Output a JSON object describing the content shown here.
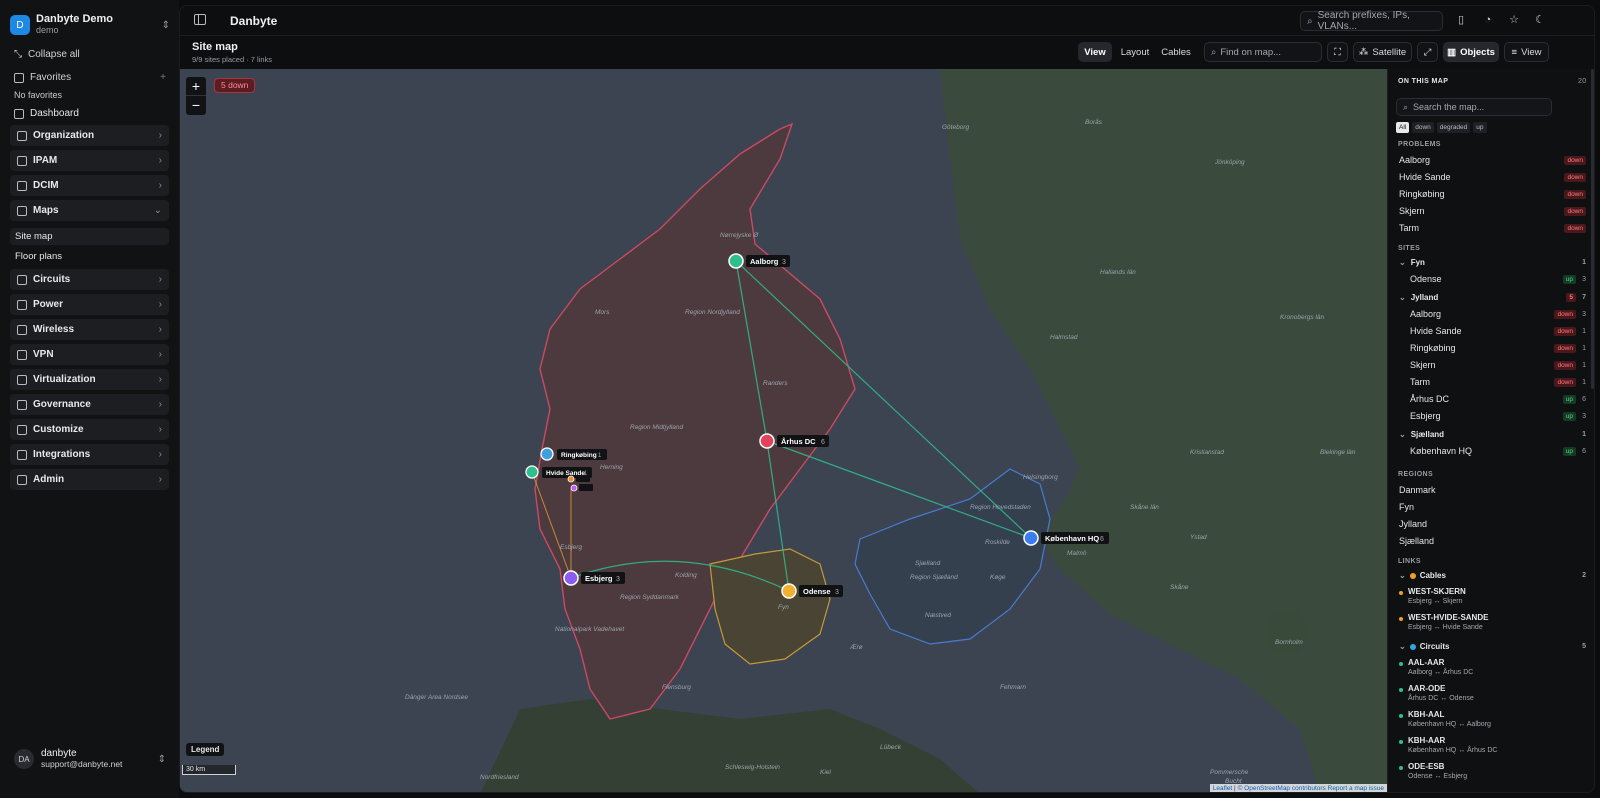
{
  "brand": {
    "name": "Danbyte Demo",
    "sub": "demo",
    "logo": "D"
  },
  "sidebar": {
    "collapse_all": "Collapse all",
    "favorites": "Favorites",
    "no_favorites": "No favorites",
    "dashboard": "Dashboard",
    "nav": [
      "Organization",
      "IPAM",
      "DCIM",
      "Maps",
      "Circuits",
      "Power",
      "Wireless",
      "VPN",
      "Virtualization",
      "Governance",
      "Customize",
      "Integrations",
      "Admin"
    ],
    "maps_sub": [
      "Site map",
      "Floor plans"
    ]
  },
  "user": {
    "initials": "DA",
    "name": "danbyte",
    "email": "support@danbyte.net"
  },
  "topbar": {
    "title": "Danbyte",
    "search_placeholder": "Search prefixes, IPs, VLANs..."
  },
  "page": {
    "title": "Site map",
    "subtitle": "9/9 sites placed · 7 links",
    "tabs": [
      "View",
      "Layout",
      "Cables"
    ],
    "find_placeholder": "Find on map...",
    "satellite": "Satellite",
    "objects": "Objects",
    "view": "View"
  },
  "map": {
    "down_badge": "5 down",
    "legend": "Legend",
    "scale": "30 km",
    "attribution": {
      "leaflet": "Leaflet",
      "osm": "© OpenStreetMap contributors",
      "report": "Report a map issue"
    },
    "place_labels": [
      "Göteborg",
      "Borås",
      "Jönköping",
      "Halmstad",
      "Helsingborg",
      "Malmö",
      "Skåne län",
      "Kristianstad",
      "Blekinge län",
      "Ystad",
      "Ærø",
      "Nørrejyske Ø",
      "Mors",
      "Randers",
      "Region Nordjylland",
      "Region Midtjylland",
      "Region Syddanmark",
      "Region Sjælland",
      "Region Hovedstaden",
      "Sjælland",
      "Fyn",
      "Kolding",
      "Flensburg",
      "Kiel",
      "Dänger Area Nordsee",
      "Nationalpark Vadehavet",
      "Esbjerg",
      "Herning",
      "Roskilde",
      "Næstved",
      "Køge",
      "Hallands län",
      "Kronobergs län",
      "Skåne",
      "Bornholm",
      "Fehmarn",
      "Lübeck",
      "Schleswig-Holstein",
      "Pommersche",
      "Bucht",
      "Nordfriesland"
    ],
    "sites": [
      {
        "name": "Aalborg",
        "count": "3",
        "color": "#2fbf8f"
      },
      {
        "name": "Århus DC",
        "count": "6",
        "color": "#e0435a"
      },
      {
        "name": "Ringkøbing",
        "count": "1",
        "color": "#3fa0e0"
      },
      {
        "name": "Hvide Sande",
        "count": "1",
        "color": "#2fbf8f"
      },
      {
        "name": "Esbjerg",
        "count": "3",
        "color": "#8a5cf0"
      },
      {
        "name": "Odense",
        "count": "3",
        "color": "#f0b030"
      },
      {
        "name": "København HQ",
        "count": "6",
        "color": "#3a7df0"
      },
      {
        "name": "Skjern",
        "count": "",
        "color": "#f08a2a"
      },
      {
        "name": "Tarm",
        "count": "",
        "color": "#c05cf0"
      }
    ]
  },
  "panel": {
    "title": "ON THIS MAP",
    "total": "20",
    "search_placeholder": "Search the map...",
    "chips": [
      "All",
      "down",
      "degraded",
      "up"
    ],
    "problems_title": "PROBLEMS",
    "problems": [
      "Aalborg",
      "Hvide Sande",
      "Ringkøbing",
      "Skjern",
      "Tarm"
    ],
    "down_label": "down",
    "up_label": "up",
    "sites_title": "SITES",
    "groups": [
      {
        "name": "Fyn",
        "count": "1",
        "sites": [
          {
            "name": "Odense",
            "status": "up",
            "count": "3"
          }
        ]
      },
      {
        "name": "Jylland",
        "count": "7",
        "badge": "5",
        "sites": [
          {
            "name": "Aalborg",
            "status": "down",
            "count": "3"
          },
          {
            "name": "Hvide Sande",
            "status": "down",
            "count": "1"
          },
          {
            "name": "Ringkøbing",
            "status": "down",
            "count": "1"
          },
          {
            "name": "Skjern",
            "status": "down",
            "count": "1"
          },
          {
            "name": "Tarm",
            "status": "down",
            "count": "1"
          },
          {
            "name": "Århus DC",
            "status": "up",
            "count": "6"
          },
          {
            "name": "Esbjerg",
            "status": "up",
            "count": "3"
          }
        ]
      },
      {
        "name": "Sjælland",
        "count": "1",
        "sites": [
          {
            "name": "København HQ",
            "status": "up",
            "count": "6"
          }
        ]
      }
    ],
    "regions_title": "REGIONS",
    "regions": [
      "Danmark",
      "Fyn",
      "Jylland",
      "Sjælland"
    ],
    "links_title": "LINKS",
    "cables": {
      "label": "Cables",
      "count": "2",
      "color": "#f0a020",
      "items": [
        {
          "name": "WEST-SKJERN",
          "desc": "Esbjerg ↔ Skjern"
        },
        {
          "name": "WEST-HVIDE-SANDE",
          "desc": "Esbjerg ↔ Hvide Sande"
        }
      ]
    },
    "circuits": {
      "label": "Circuits",
      "count": "5",
      "color": "#30a8e0",
      "items": [
        {
          "name": "AAL-AAR",
          "desc": "Aalborg ↔ Århus DC"
        },
        {
          "name": "AAR-ODE",
          "desc": "Århus DC ↔ Odense"
        },
        {
          "name": "KBH-AAL",
          "desc": "København HQ ↔ Aalborg"
        },
        {
          "name": "KBH-AAR",
          "desc": "København HQ ↔ Århus DC"
        },
        {
          "name": "ODE-ESB",
          "desc": "Odense ↔ Esbjerg"
        }
      ]
    }
  }
}
